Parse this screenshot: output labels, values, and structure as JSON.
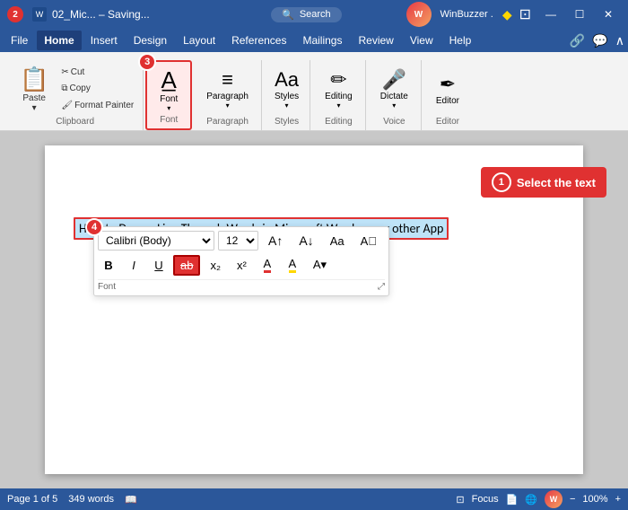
{
  "titleBar": {
    "fileName": "02_Mic... – Saving...",
    "appName": "WinBuzzer .",
    "searchPlaceholder": "Search",
    "redBadge": "2",
    "minBtn": "—",
    "maxBtn": "☐",
    "closeBtn": "✕"
  },
  "menuBar": {
    "items": [
      "File",
      "Home",
      "Insert",
      "Design",
      "Layout",
      "References",
      "Mailings",
      "Review",
      "View",
      "Help"
    ],
    "activeItem": "Home"
  },
  "ribbon": {
    "clipboard": {
      "label": "Clipboard",
      "paste": "Paste",
      "cut": "Cut",
      "copy": "Copy",
      "formatPainter": "Format Painter"
    },
    "font": {
      "label": "Font",
      "badge": "3"
    },
    "paragraph": {
      "label": "Paragraph"
    },
    "styles": {
      "label": "Styles",
      "badge": null
    },
    "editing": {
      "label": "Editing"
    },
    "dictate": {
      "label": "Dictate"
    },
    "editor": {
      "label": "Editor"
    }
  },
  "fontBar": {
    "fontName": "Calibri (Body)",
    "fontSize": "12",
    "badge4": "4",
    "boldLabel": "B",
    "italicLabel": "I",
    "underlineLabel": "U",
    "strikethroughLabel": "ab",
    "subscriptLabel": "x₂",
    "superscriptLabel": "x²",
    "fontColorLabel": "A",
    "highlightLabel": "A",
    "footerLabel": "Font"
  },
  "document": {
    "selectedText": "How to Draw a Line Through Words in Microsoft Word or any other App"
  },
  "annotations": {
    "bubble1": {
      "number": "1",
      "text": "Select the text"
    }
  },
  "statusBar": {
    "pageInfo": "Page 1 of 5",
    "wordCount": "349 words",
    "focusLabel": "Focus",
    "zoom": "100%",
    "zoomLabel": "100%"
  }
}
